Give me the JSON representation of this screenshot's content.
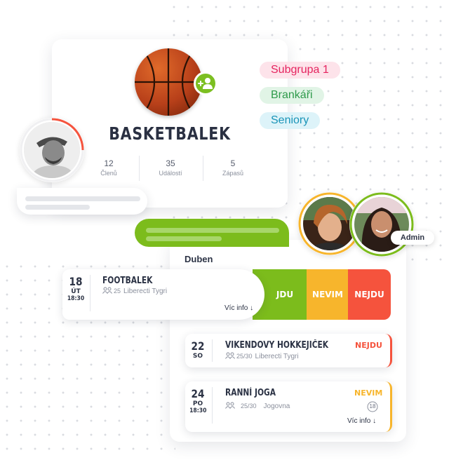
{
  "group": {
    "name": "BASKETBALEK",
    "stats": [
      {
        "value": "12",
        "label": "Členů"
      },
      {
        "value": "35",
        "label": "Událostí"
      },
      {
        "value": "5",
        "label": "Zápasů"
      }
    ]
  },
  "tags": [
    {
      "label": "Subgrupa 1",
      "color": "#e5245f",
      "bg": "#fde3ea"
    },
    {
      "label": "Brankáři",
      "color": "#2e9a4b",
      "bg": "#e1f4e6"
    },
    {
      "label": "Seniory",
      "color": "#1a94b8",
      "bg": "#ddf3f9"
    }
  ],
  "admin_badge": "Admin",
  "calendar": {
    "month": "Duben",
    "events": [
      {
        "day": "18",
        "weekday": "ÚT",
        "time": "18:30",
        "title": "FOOTBALEK",
        "attendance": "25",
        "location": "Liberecti Tygri",
        "more": "Víc info ↓",
        "actions": {
          "going": "JDU",
          "unsure": "NEVIM",
          "not_going": "NEJDU"
        }
      },
      {
        "day": "22",
        "weekday": "SO",
        "title": "VIKENDOVY HOKKEJIČEK",
        "attendance": "25/30",
        "location": "Liberecti Tygri",
        "status": "NEJDU"
      },
      {
        "day": "24",
        "weekday": "PO",
        "time": "18:30",
        "title": "RANNÍ JOGA",
        "attendance": "25/30",
        "location": "Jogovna",
        "status": "NEVIM",
        "age_badge": "18",
        "more": "Víc info ↓"
      }
    ]
  },
  "colors": {
    "green": "#7cbc1c",
    "orange": "#f7b52c",
    "red": "#f5533d",
    "text": "#2c3345"
  },
  "icons": [
    "add-member-icon",
    "people-icon",
    "age-18-icon",
    "basketball-image",
    "member-avatar"
  ]
}
